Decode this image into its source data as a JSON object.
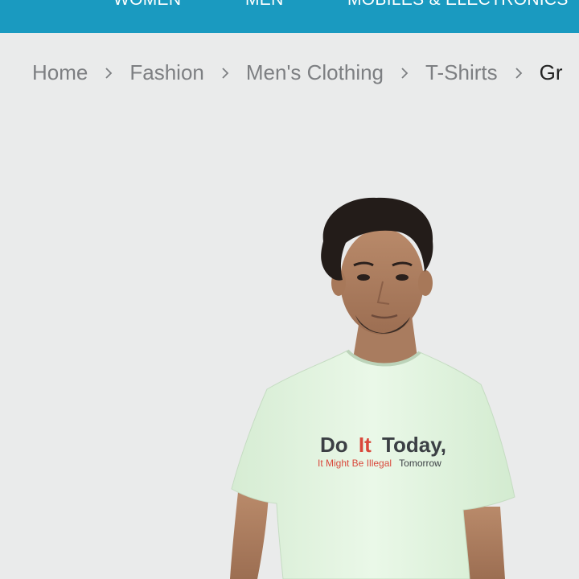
{
  "topnav": {
    "items": [
      {
        "label": "WOMEN"
      },
      {
        "label": "MEN"
      },
      {
        "label": "MOBILES & ELECTRONICS"
      }
    ]
  },
  "breadcrumb": {
    "items": [
      {
        "label": "Home"
      },
      {
        "label": "Fashion"
      },
      {
        "label": "Men's Clothing"
      },
      {
        "label": "T-Shirts"
      },
      {
        "label": "Gr"
      }
    ],
    "separator_icon": "chevron-right-icon"
  },
  "product": {
    "shirt_text_line1": [
      "Do",
      "It",
      "Today,"
    ],
    "shirt_text_line2": [
      "It Might Be Illegal",
      "Tomorrow"
    ]
  },
  "colors": {
    "nav_bg": "#1a9ac0",
    "page_bg": "#eaebeb",
    "shirt": "#e4f5e2",
    "accent_red": "#d9483b"
  }
}
